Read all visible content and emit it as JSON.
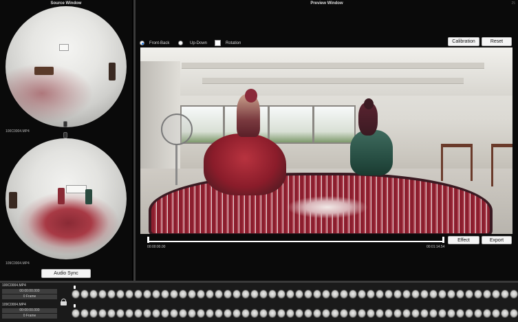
{
  "source_window": {
    "title": "Source Window",
    "camera1": "100C0004.MP4",
    "camera2": "109C0004.MP4",
    "audio_sync_label": "Audio Sync"
  },
  "preview_window": {
    "title": "Preview Window",
    "corner_text": "25",
    "options": {
      "front_back": "Front-Back",
      "up_down": "Up-Down",
      "rotation": "Rotation",
      "selected": "front_back"
    },
    "calibration_label": "Calibration",
    "reset_label": "Reset",
    "effect_label": "Effect",
    "export_label": "Export",
    "time_start": "00:00:00.00",
    "time_end": "00:01:14.54"
  },
  "tracks": [
    {
      "name": "100C0004.MP4",
      "timecode": "00:00:00.000",
      "frame": "0 Frame"
    },
    {
      "name": "109C0004.MP4",
      "timecode": "00:00:00.000",
      "frame": "0 Frame"
    }
  ],
  "colors": {
    "accent": "#2a7de1",
    "rug_red": "#8c1e2e"
  }
}
